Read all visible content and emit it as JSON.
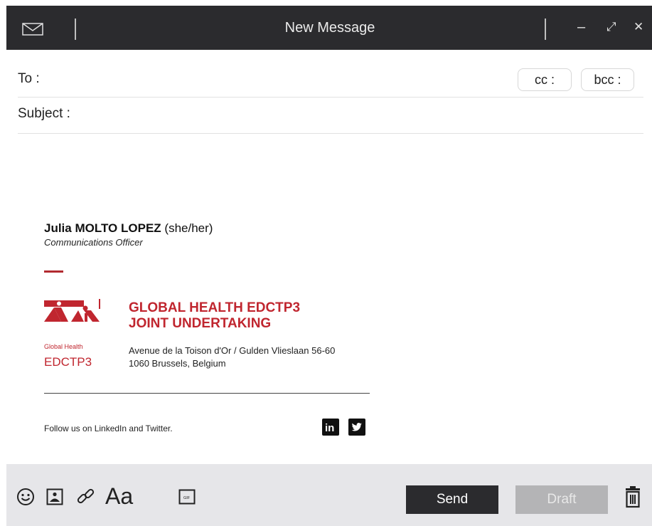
{
  "window": {
    "title": "New Message",
    "controls": {
      "minimize": "–",
      "expand": "⤢",
      "close": "✕"
    }
  },
  "compose": {
    "to_label": "To :",
    "cc_label": "cc :",
    "bcc_label": "bcc :",
    "subject_label": "Subject :"
  },
  "signature": {
    "name": "Julia MOLTO LOPEZ",
    "pronouns": "(she/her)",
    "role": "Communications Officer",
    "org_line1": "GLOBAL HEALTH EDCTP3",
    "org_line2": "JOINT UNDERTAKING",
    "logo_text_small": "Global Health",
    "logo_text_big": "EDCTP3",
    "address_line1": "Avenue de la Toison d'Or / Gulden Vlieslaan 56-60",
    "address_line2": "1060 Brussels, Belgium",
    "follow_text": "Follow us on LinkedIn and Twitter.",
    "linkedin_text": "in"
  },
  "toolbar": {
    "format_label": "Aa",
    "gif_label": "GIF",
    "send_label": "Send",
    "draft_label": "Draft"
  },
  "colors": {
    "titlebar": "#2b2b2e",
    "brand_red": "#c0262f",
    "toolbar_bg": "#e6e6e9",
    "draft_bg": "#b4b4b6"
  }
}
